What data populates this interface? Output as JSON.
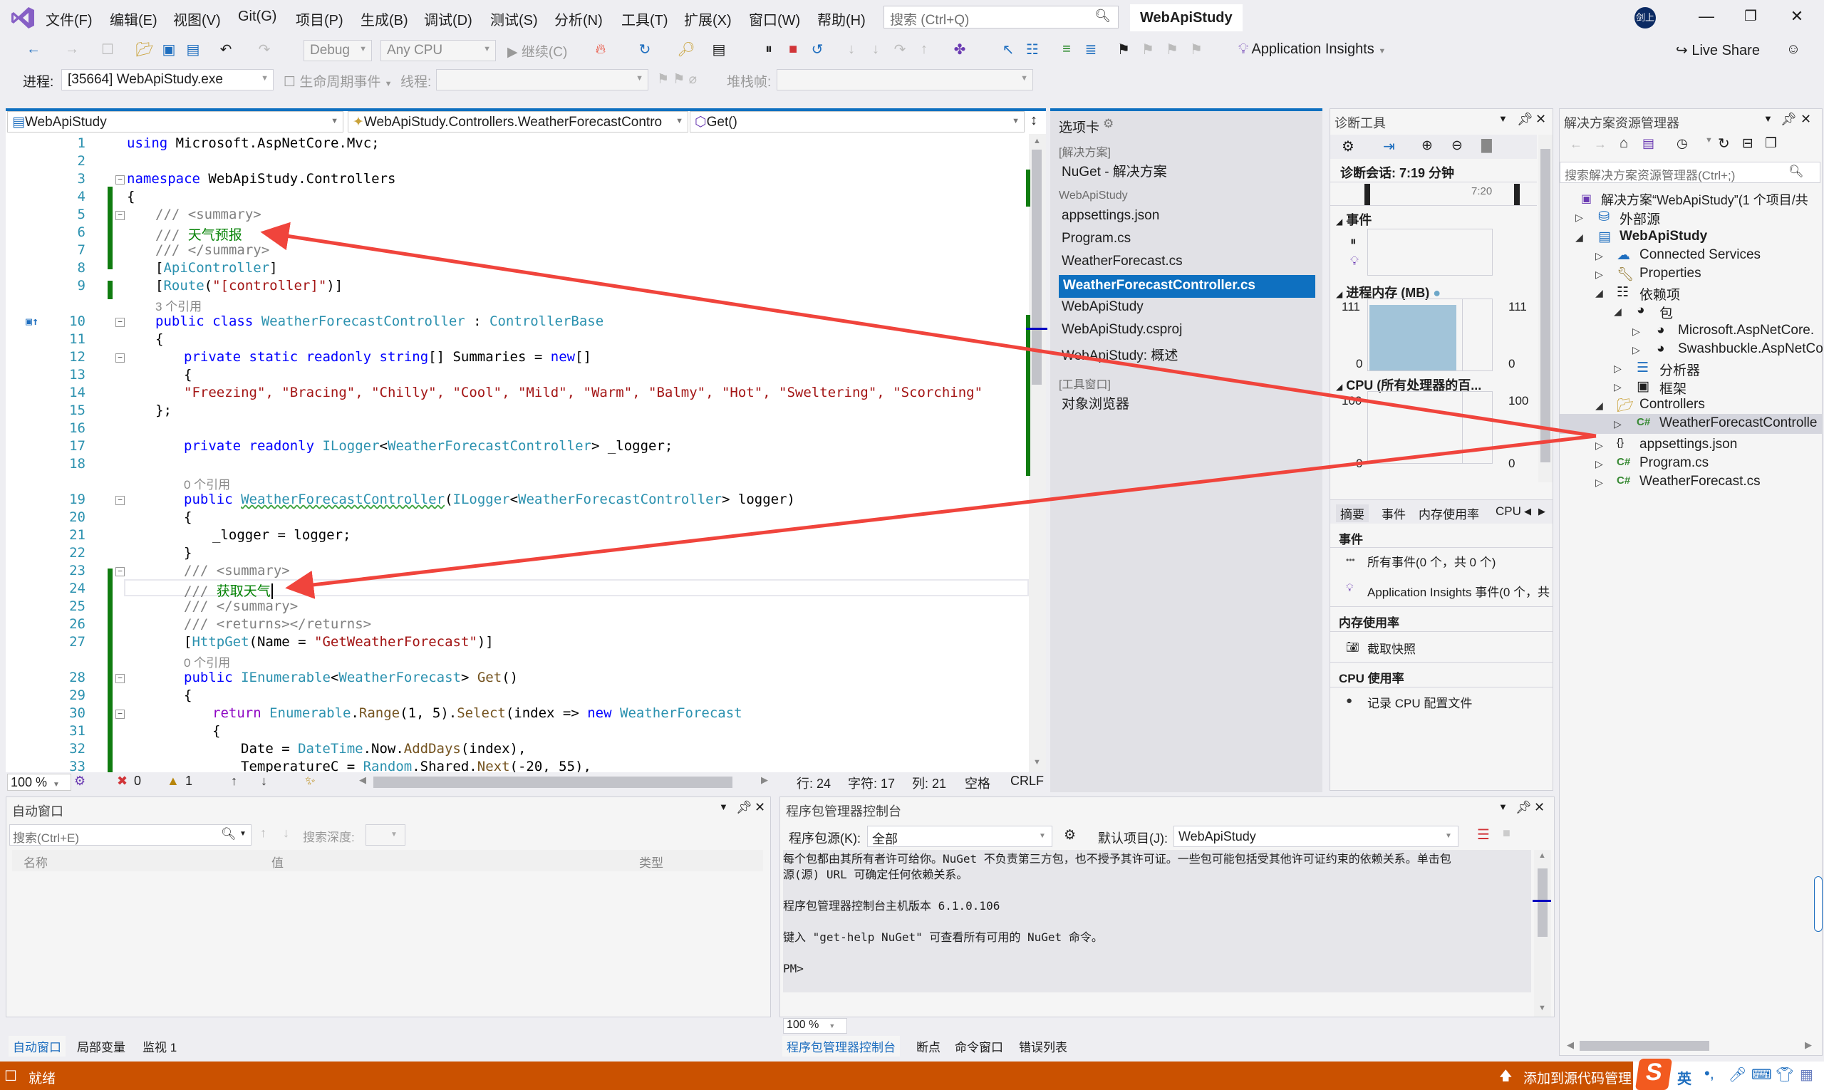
{
  "menubar": {
    "items": [
      "文件(F)",
      "编辑(E)",
      "视图(V)",
      "Git(G)",
      "项目(P)",
      "生成(B)",
      "调试(D)",
      "测试(S)",
      "分析(N)",
      "工具(T)",
      "扩展(X)",
      "窗口(W)",
      "帮助(H)"
    ],
    "search_placeholder": "搜索 (Ctrl+Q)",
    "solution_name": "WebApiStudy",
    "avatar_text": "剑上"
  },
  "toolbar": {
    "config": "Debug",
    "platform": "Any CPU",
    "continue_label": "继续(C)",
    "app_insights": "Application Insights",
    "live_share": "Live Share"
  },
  "debugbar": {
    "process_label": "进程:",
    "process_value": "[35664] WebApiStudy.exe",
    "lifecycle_label": "生命周期事件",
    "thread_label": "线程:",
    "stackframe_label": "堆栈帧:"
  },
  "editor": {
    "nav_project": "WebApiStudy",
    "nav_class": "WebApiStudy.Controllers.WeatherForecastContro",
    "nav_member": "Get()",
    "refs": {
      "r3": "3 个引用",
      "r0a": "0 个引用",
      "r0b": "0 个引用"
    },
    "lines": {
      "l1a": "using",
      "l1b": " Microsoft.AspNetCore.Mvc;",
      "l3a": "namespace",
      "l3b": " WebApiStudy.Controllers",
      "l4": "{",
      "l5": "/// <summary>",
      "l6a": "/// ",
      "l6b": "天气预报",
      "l7": "/// </summary>",
      "l8a": "[",
      "l8b": "ApiController",
      "l8c": "]",
      "l9a": "[",
      "l9b": "Route",
      "l9c": "(",
      "l9d": "\"[controller]\"",
      "l9e": ")]",
      "l10a": "public class ",
      "l10b": "WeatherForecastController",
      "l10c": " : ",
      "l10d": "ControllerBase",
      "l11": "{",
      "l12a": "private static readonly string",
      "l12b": "[] Summaries = ",
      "l12c": "new",
      "l12d": "[]",
      "l13": "{",
      "l14": "\"Freezing\", \"Bracing\", \"Chilly\", \"Cool\", \"Mild\", \"Warm\", \"Balmy\", \"Hot\", \"Sweltering\", \"Scorching\"",
      "l15": "};",
      "l17a": "private readonly ",
      "l17b": "ILogger",
      "l17c": "<",
      "l17d": "WeatherForecastController",
      "l17e": "> _logger;",
      "l19a": "public ",
      "l19b": "WeatherForecastController",
      "l19c": "(",
      "l19d": "ILogger",
      "l19e": "<",
      "l19f": "WeatherForecastController",
      "l19g": "> logger)",
      "l20": "{",
      "l21": "_logger = logger;",
      "l22": "}",
      "l23": "/// <summary>",
      "l24a": "/// ",
      "l24b": "获取天气",
      "l25": "/// </summary>",
      "l26": "/// <returns></returns>",
      "l27a": "[",
      "l27b": "HttpGet",
      "l27c": "(Name = ",
      "l27d": "\"GetWeatherForecast\"",
      "l27e": ")]",
      "l28a": "public ",
      "l28b": "IEnumerable",
      "l28c": "<",
      "l28d": "WeatherForecast",
      "l28e": "> ",
      "l28f": "Get",
      "l28g": "()",
      "l29": "{",
      "l30a": "return ",
      "l30b": "Enumerable",
      "l30c": ".",
      "l30d": "Range",
      "l30e": "(1, 5).",
      "l30f": "Select",
      "l30g": "(index => ",
      "l30h": "new ",
      "l30i": "WeatherForecast",
      "l31": "{",
      "l32a": "Date = ",
      "l32b": "DateTime",
      "l32c": ".Now.",
      "l32d": "AddDays",
      "l32e": "(index),",
      "l33a": "TemperatureC = ",
      "l33b": "Random",
      "l33c": ".Shared.",
      "l33d": "Next",
      "l33e": "(-20, 55),"
    },
    "status": {
      "zoom": "100 %",
      "errors": "0",
      "warnings": "1",
      "line": "行: 24",
      "char": "字符: 17",
      "col": "列: 21",
      "spaces": "空格",
      "eol": "CRLF"
    }
  },
  "tablist": {
    "title": "选项卡",
    "group_solution": "[解决方案]",
    "nuget": "NuGet - 解决方案",
    "group_project": "WebApiStudy",
    "items": [
      "appsettings.json",
      "Program.cs",
      "WeatherForecast.cs",
      "WeatherForecastController.cs",
      "WebApiStudy",
      "WebApiStudy.csproj",
      "WebApiStudy: 概述"
    ],
    "selected_index": 3,
    "group_tools": "[工具窗口]",
    "object_browser": "对象浏览器"
  },
  "diagnostics": {
    "title": "诊断工具",
    "session": "诊断会话: 7:19 分钟",
    "timeline_label": "7:20",
    "events_section": "事件",
    "memory_section": "进程内存 (MB)",
    "memory_max": "111",
    "memory_min": "0",
    "memory_level": 1.0,
    "cpu_section": "CPU (所有处理器的百...",
    "cpu_max": "100",
    "cpu_min": "0",
    "tabs": [
      "摘要",
      "事件",
      "内存使用率",
      "CPU"
    ],
    "summary": {
      "events_header": "事件",
      "all_events": "所有事件(0 个，共 0 个)",
      "ai_events": "Application Insights 事件(0 个，共",
      "memory_header": "内存使用率",
      "snapshot": "截取快照",
      "cpu_header": "CPU 使用率",
      "record_cpu": "记录 CPU 配置文件"
    }
  },
  "solution_explorer": {
    "title": "解决方案资源管理器",
    "search_placeholder": "搜索解决方案资源管理器(Ctrl+;)",
    "solution": "解决方案“WebApiStudy”(1 个项目/共",
    "external": "外部源",
    "project": "WebApiStudy",
    "connected": "Connected Services",
    "properties": "Properties",
    "deps": "依赖项",
    "packages": "包",
    "pkg1": "Microsoft.AspNetCore.",
    "pkg2": "Swashbuckle.AspNetCo",
    "analyzers": "分析器",
    "frameworks": "框架",
    "controllers": "Controllers",
    "controller_file": "WeatherForecastControlle",
    "appsettings": "appsettings.json",
    "program": "Program.cs",
    "weather": "WeatherForecast.cs"
  },
  "autos": {
    "title": "自动窗口",
    "search_placeholder": "搜索(Ctrl+E)",
    "depth_label": "搜索深度:",
    "col_name": "名称",
    "col_value": "值",
    "col_type": "类型",
    "tabs": [
      "自动窗口",
      "局部变量",
      "监视 1"
    ]
  },
  "pmc": {
    "title": "程序包管理器控制台",
    "source_label": "程序包源(K):",
    "source_value": "全部",
    "project_label": "默认项目(J):",
    "project_value": "WebApiStudy",
    "line1": "每个包都由其所有者许可给你。NuGet 不负责第三方包，也不授予其许可证。一些包可能包括受其他许可证约束的依赖关系。单击包",
    "line2": "源(源) URL 可确定任何依赖关系。",
    "line3": "程序包管理器控制台主机版本 6.1.0.106",
    "line4": "键入 \"get-help NuGet\" 可查看所有可用的 NuGet 命令。",
    "prompt": "PM>",
    "zoom": "100 %",
    "tabs": [
      "程序包管理器控制台",
      "断点",
      "命令窗口",
      "错误列表"
    ]
  },
  "statusbar": {
    "ready": "就绪",
    "source_control": "添加到源代码管理",
    "ime_lang": "英"
  },
  "colors": {
    "accent": "#0e70c0",
    "status_bar": "#ca5100",
    "selection": "#0e70c0",
    "annotation_arrow": "#f0443c"
  }
}
